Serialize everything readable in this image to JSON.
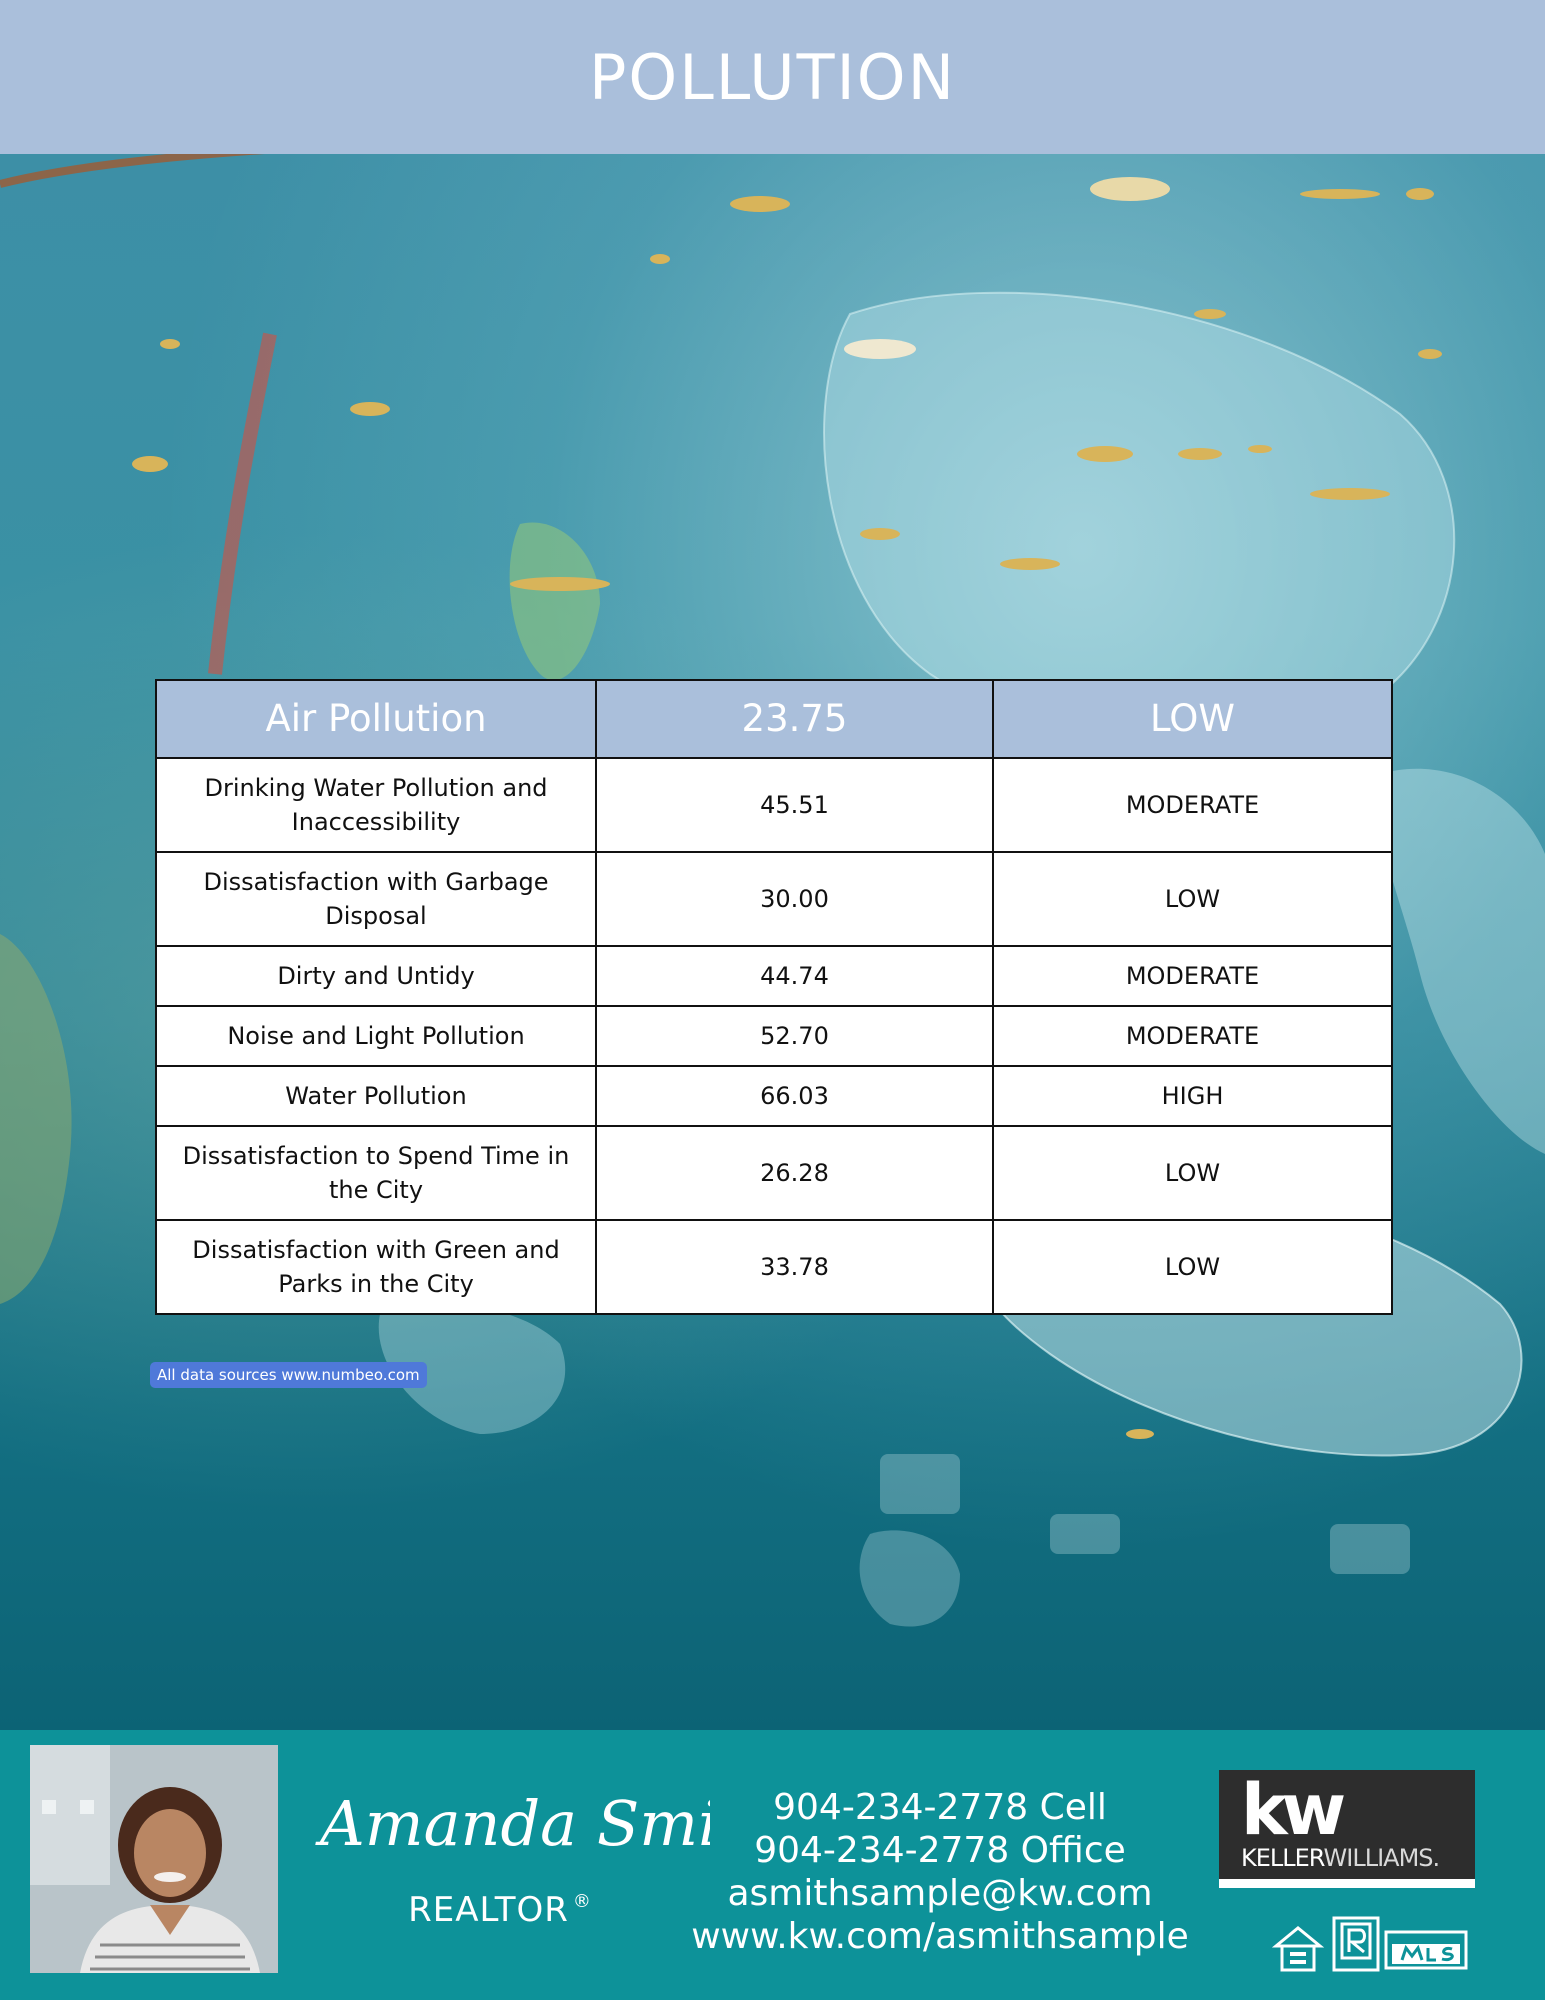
{
  "header": {
    "title": "POLLUTION"
  },
  "table": {
    "head": {
      "label": "Air Pollution",
      "value": "23.75",
      "level": "LOW"
    },
    "rows": [
      {
        "label": "Drinking Water Pollution and Inaccessibility",
        "value": "45.51",
        "level": "MODERATE"
      },
      {
        "label": "Dissatisfaction with Garbage Disposal",
        "value": "30.00",
        "level": "LOW"
      },
      {
        "label": "Dirty and Untidy",
        "value": "44.74",
        "level": "MODERATE"
      },
      {
        "label": "Noise and Light Pollution",
        "value": "52.70",
        "level": "MODERATE"
      },
      {
        "label": "Water Pollution",
        "value": "66.03",
        "level": "HIGH"
      },
      {
        "label": "Dissatisfaction to Spend Time in the City",
        "value": "26.28",
        "level": "LOW"
      },
      {
        "label": "Dissatisfaction with Green and Parks in the City",
        "value": "33.78",
        "level": "LOW"
      }
    ]
  },
  "source_note": "All data sources www.numbeo.com",
  "agent": {
    "signature": "Amanda Smith",
    "title": "REALTOR",
    "title_mark": "®",
    "phone_cell": "904-234-2778 Cell",
    "phone_office": "904-234-2778 Office",
    "email": "asmithsample@kw.com",
    "website": "www.kw.com/asmithsample"
  },
  "brand": {
    "logo_mark": "kw",
    "logo_name_bold": "KELLER",
    "logo_name_light": "WILLIAMS.",
    "badge_icons": [
      "equal-housing-opportunity-icon",
      "realtor-r-icon",
      "mls-icon"
    ]
  },
  "colors": {
    "header_band": "#aabfdb",
    "footer_band": "#0d9299",
    "badge": "#4f79d9",
    "logo_bg": "#2d2d2d"
  }
}
